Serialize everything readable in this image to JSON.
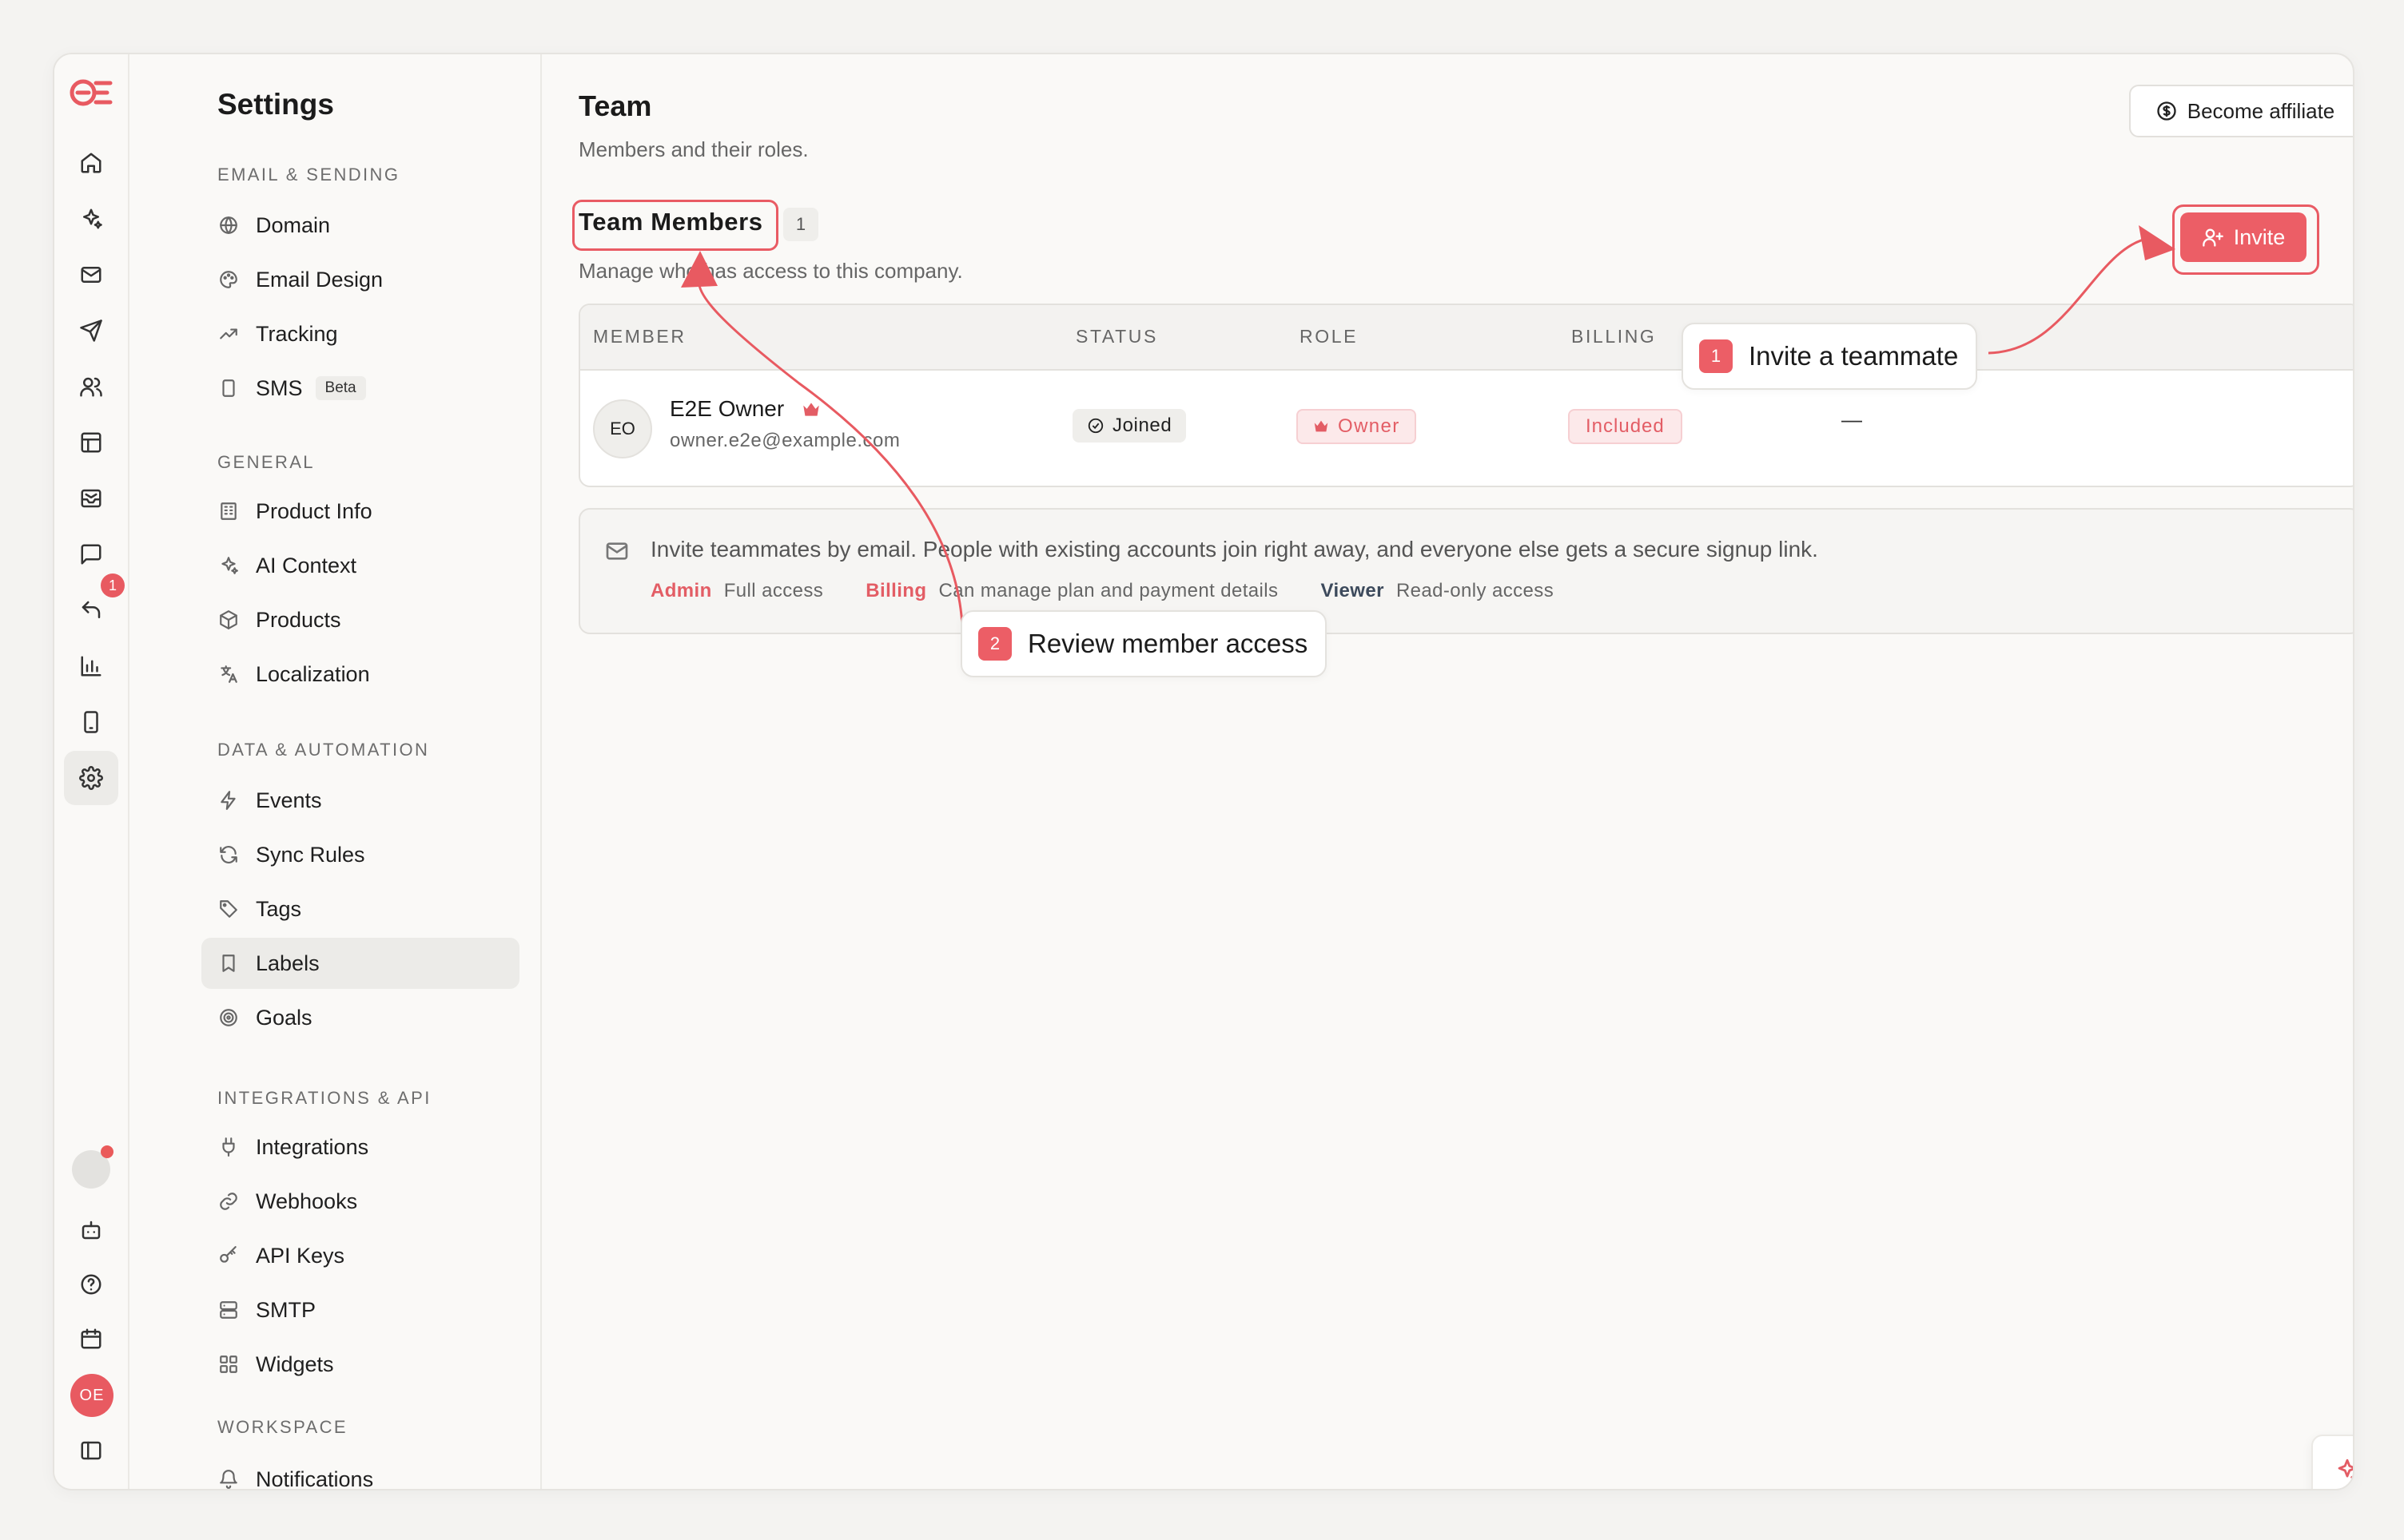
{
  "rail": {
    "items": [
      "home-icon",
      "sparkles-icon",
      "mail-icon",
      "send-icon",
      "users-icon",
      "layout-icon",
      "inbox-icon",
      "message-icon",
      "reply-icon",
      "bar-chart-icon",
      "phone-icon",
      "settings-icon"
    ],
    "badge": "1",
    "user_initials": "OE"
  },
  "sidebar": {
    "title": "Settings",
    "sections": {
      "email_sending": "EMAIL & SENDING",
      "general": "GENERAL",
      "data_automation": "DATA & AUTOMATION",
      "integrations_api": "INTEGRATIONS & API",
      "workspace": "WORKSPACE"
    },
    "items": {
      "domain": "Domain",
      "email_design": "Email Design",
      "tracking": "Tracking",
      "sms": "SMS",
      "sms_badge": "Beta",
      "product_info": "Product Info",
      "ai_context": "AI Context",
      "products": "Products",
      "localization": "Localization",
      "events": "Events",
      "sync_rules": "Sync Rules",
      "tags": "Tags",
      "labels": "Labels",
      "goals": "Goals",
      "integrations": "Integrations",
      "webhooks": "Webhooks",
      "api_keys": "API Keys",
      "smtp": "SMTP",
      "widgets": "Widgets",
      "notifications": "Notifications"
    }
  },
  "main": {
    "title": "Team",
    "subtitle": "Members and their roles.",
    "affiliate_label": "Become affiliate",
    "team_members_title": "Team Members",
    "team_members_count": "1",
    "team_members_sub": "Manage who has access to this company.",
    "invite_label": "Invite",
    "table": {
      "headers": {
        "member": "MEMBER",
        "status": "STATUS",
        "role": "ROLE",
        "billing": "BILLING"
      },
      "row": {
        "initials": "EO",
        "name": "E2E Owner",
        "email": "owner.e2e@example.com",
        "status": "Joined",
        "role": "Owner",
        "billing": "Included",
        "extra": "—"
      }
    },
    "info": {
      "text": "Invite teammates by email. People with existing accounts join right away, and everyone else gets a secure signup link.",
      "admin_name": "Admin",
      "admin_desc": "Full access",
      "billing_name": "Billing",
      "billing_desc": "Can manage plan and payment details",
      "viewer_name": "Viewer",
      "viewer_desc": "Read-only access"
    }
  },
  "callouts": {
    "one_num": "1",
    "one_text": "Invite a teammate",
    "two_num": "2",
    "two_text": "Review member access"
  },
  "colors": {
    "accent": "#ec5e66",
    "background": "#faf9f7"
  }
}
